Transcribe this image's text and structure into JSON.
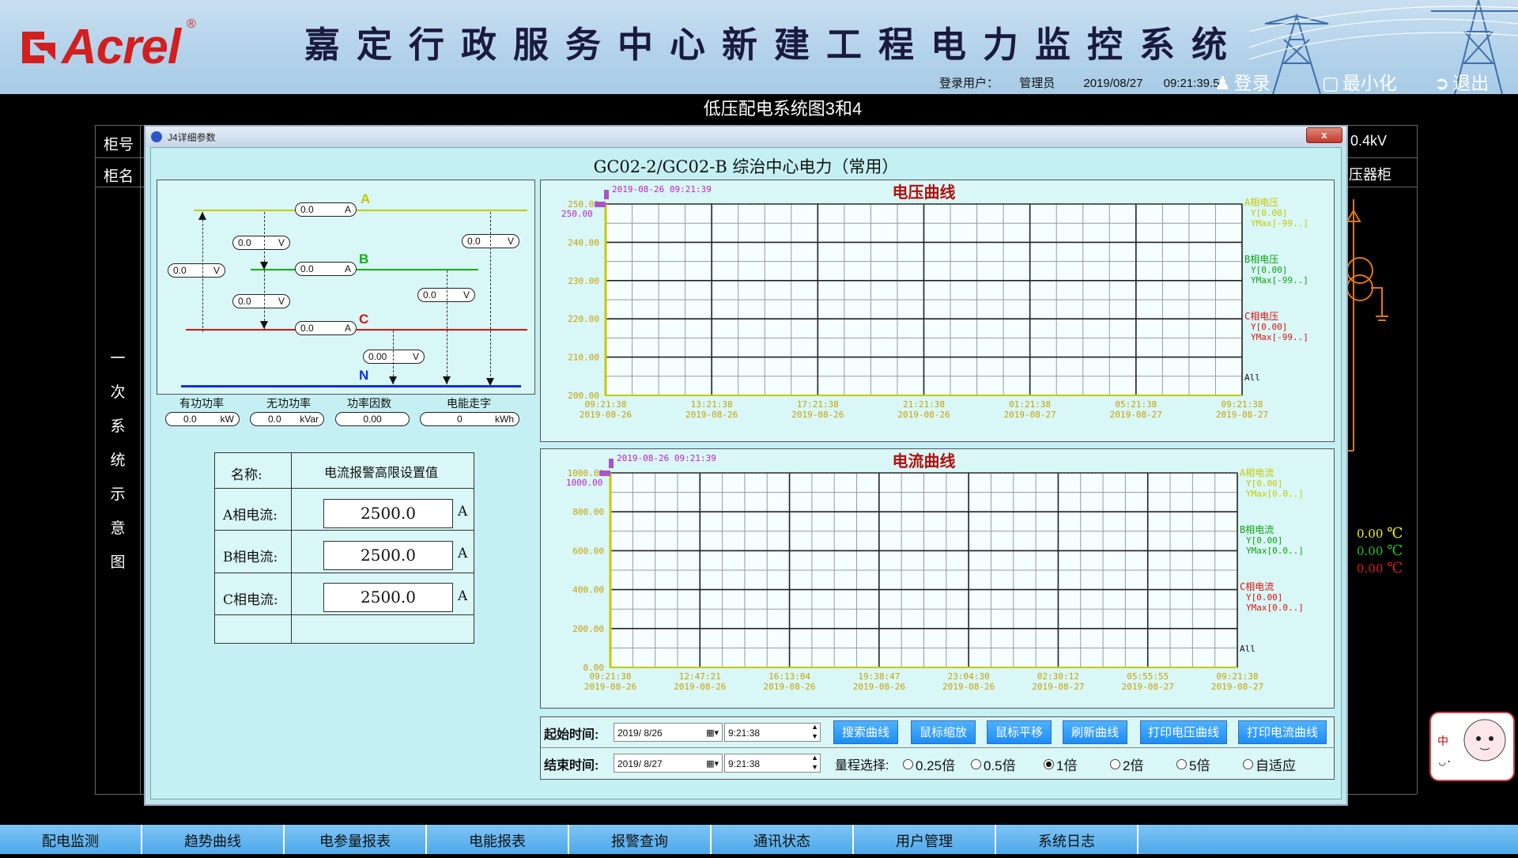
{
  "header": {
    "logo": "Acrel",
    "logo_reg": "®",
    "system_title": "嘉定行政服务中心新建工程电力监控系统",
    "user_label": "登录用户：",
    "user_name": "管理员",
    "date": "2019/08/27",
    "time": "09:21:39.5",
    "login_label": "登录",
    "minimize_label": "最小化",
    "exit_label": "退出"
  },
  "page_title": "低压配电系统图3和4",
  "background": {
    "cabinet_no_label": "柜号",
    "cabinet_name_label": "柜名",
    "vertical_label": [
      "一",
      "次",
      "系",
      "统",
      "示",
      "意",
      "图"
    ],
    "right_voltage": "0.4kV",
    "right_cabinet": "压器柜",
    "temps": [
      {
        "value": "0.00",
        "unit": "℃",
        "color": "#f2f21a"
      },
      {
        "value": "0.00",
        "unit": "℃",
        "color": "#1ac81a"
      },
      {
        "value": "0.00",
        "unit": "℃",
        "color": "#e01a1a"
      }
    ]
  },
  "dialog": {
    "window_title": "J4详细参数",
    "close_label": "x",
    "heading": "GC02-2/GC02-B 综治中心电力（常用）",
    "diagram": {
      "phase_a": "A",
      "phase_b": "B",
      "phase_c": "C",
      "phase_n": "N",
      "ia": {
        "value": "0.0",
        "unit": "A"
      },
      "ib": {
        "value": "0.0",
        "unit": "A"
      },
      "ic": {
        "value": "0.0",
        "unit": "A"
      },
      "uab": {
        "value": "0.0",
        "unit": "V"
      },
      "ubc": {
        "value": "0.0",
        "unit": "V"
      },
      "uca": {
        "value": "0.0",
        "unit": "V"
      },
      "ua": {
        "value": "0.0",
        "unit": "V"
      },
      "ub": {
        "value": "0.0",
        "unit": "V"
      },
      "uc": {
        "value": "0.00",
        "unit": "V"
      },
      "p_label": "有功功率",
      "q_label": "无功功率",
      "pf_label": "功率因数",
      "e_label": "电能走字",
      "p": {
        "value": "0.0",
        "unit": "kW"
      },
      "q": {
        "value": "0.0",
        "unit": "kVar"
      },
      "pf": {
        "value": "0.00",
        "unit": ""
      },
      "e": {
        "value": "0",
        "unit": "kWh"
      }
    },
    "settings": {
      "name_label": "名称:",
      "name_value": "电流报警高限设置值",
      "rows": [
        {
          "label": "A相电流:",
          "value": "2500.0",
          "unit": "A"
        },
        {
          "label": "B相电流:",
          "value": "2500.0",
          "unit": "A"
        },
        {
          "label": "C相电流:",
          "value": "2500.0",
          "unit": "A"
        }
      ]
    },
    "controls": {
      "start_label": "起始时间:",
      "end_label": "结束时间:",
      "start_date": "2019/ 8/26",
      "start_time": "9:21:38",
      "end_date": "2019/ 8/27",
      "end_time": "9:21:38",
      "buttons": [
        "搜索曲线",
        "鼠标缩放",
        "鼠标平移",
        "刷新曲线",
        "打印电压曲线",
        "打印电流曲线"
      ],
      "range_label": "量程选择:",
      "ranges": [
        {
          "label": "0.25倍",
          "checked": false
        },
        {
          "label": "0.5倍",
          "checked": false
        },
        {
          "label": "1倍",
          "checked": true
        },
        {
          "label": "2倍",
          "checked": false
        },
        {
          "label": "5倍",
          "checked": false
        },
        {
          "label": "自适应",
          "checked": false
        }
      ]
    }
  },
  "chart_data": [
    {
      "type": "line",
      "title": "电压曲线",
      "cursor_label": "2019-08-26 09:21:39",
      "cursor_value": "250.00",
      "ylim": [
        200,
        250
      ],
      "yticks": [
        "250.00",
        "240.00",
        "230.00",
        "220.00",
        "210.00",
        "200.00"
      ],
      "xticks": [
        {
          "time": "09:21:38",
          "date": "2019-08-26"
        },
        {
          "time": "13:21:38",
          "date": "2019-08-26"
        },
        {
          "time": "17:21:38",
          "date": "2019-08-26"
        },
        {
          "time": "21:21:38",
          "date": "2019-08-26"
        },
        {
          "time": "01:21:38",
          "date": "2019-08-27"
        },
        {
          "time": "05:21:38",
          "date": "2019-08-27"
        },
        {
          "time": "09:21:38",
          "date": "2019-08-27"
        }
      ],
      "legend": [
        {
          "name": "A相电压",
          "y": "Y[0.00]",
          "ymax": "YMax[-99..]",
          "color": "#c8c800"
        },
        {
          "name": "B相电压",
          "y": "Y[0.00]",
          "ymax": "YMax[-99..]",
          "color": "#10a010"
        },
        {
          "name": "C相电压",
          "y": "Y[0.00]",
          "ymax": "YMax[-99..]",
          "color": "#e01010"
        }
      ],
      "legend_all": "All",
      "series": []
    },
    {
      "type": "line",
      "title": "电流曲线",
      "cursor_label": "2019-08-26 09:21:39",
      "cursor_value": "1000.00",
      "ylim": [
        0,
        1000
      ],
      "yticks": [
        "1000.00",
        "800.00",
        "600.00",
        "400.00",
        "200.00",
        "0.00"
      ],
      "xticks": [
        {
          "time": "09:21:38",
          "date": "2019-08-26"
        },
        {
          "time": "12:47:21",
          "date": "2019-08-26"
        },
        {
          "time": "16:13:04",
          "date": "2019-08-26"
        },
        {
          "time": "19:38:47",
          "date": "2019-08-26"
        },
        {
          "time": "23:04:30",
          "date": "2019-08-26"
        },
        {
          "time": "02:30:12",
          "date": "2019-08-27"
        },
        {
          "time": "05:55:55",
          "date": "2019-08-27"
        },
        {
          "time": "09:21:38",
          "date": "2019-08-27"
        }
      ],
      "legend": [
        {
          "name": "A相电流",
          "y": "Y[0.00]",
          "ymax": "YMax[0.0..]",
          "color": "#c8c800"
        },
        {
          "name": "B相电流",
          "y": "Y[0.00]",
          "ymax": "YMax[0.0..]",
          "color": "#10a010"
        },
        {
          "name": "C相电流",
          "y": "Y[0.00]",
          "ymax": "YMax[0.0..]",
          "color": "#e01010"
        }
      ],
      "legend_all": "All",
      "series": []
    }
  ],
  "bottom_nav": [
    "配电监测",
    "趋势曲线",
    "电参量报表",
    "电能报表",
    "报警查询",
    "通讯状态",
    "用户管理",
    "系统日志"
  ]
}
